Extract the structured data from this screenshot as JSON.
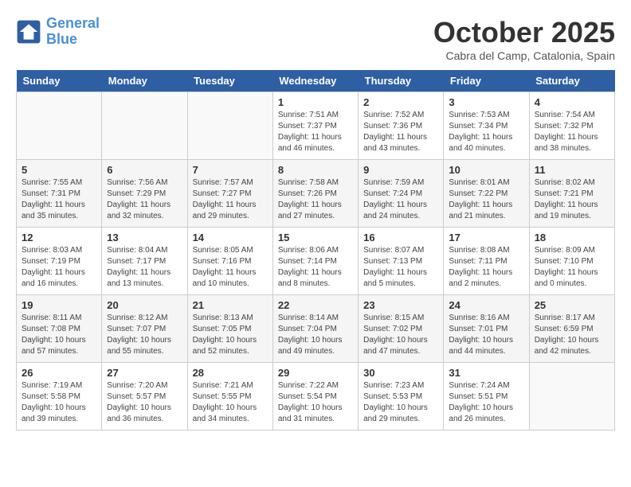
{
  "header": {
    "logo_line1": "General",
    "logo_line2": "Blue",
    "month": "October 2025",
    "location": "Cabra del Camp, Catalonia, Spain"
  },
  "days_of_week": [
    "Sunday",
    "Monday",
    "Tuesday",
    "Wednesday",
    "Thursday",
    "Friday",
    "Saturday"
  ],
  "weeks": [
    [
      {
        "day": "",
        "info": ""
      },
      {
        "day": "",
        "info": ""
      },
      {
        "day": "",
        "info": ""
      },
      {
        "day": "1",
        "info": "Sunrise: 7:51 AM\nSunset: 7:37 PM\nDaylight: 11 hours\nand 46 minutes."
      },
      {
        "day": "2",
        "info": "Sunrise: 7:52 AM\nSunset: 7:36 PM\nDaylight: 11 hours\nand 43 minutes."
      },
      {
        "day": "3",
        "info": "Sunrise: 7:53 AM\nSunset: 7:34 PM\nDaylight: 11 hours\nand 40 minutes."
      },
      {
        "day": "4",
        "info": "Sunrise: 7:54 AM\nSunset: 7:32 PM\nDaylight: 11 hours\nand 38 minutes."
      }
    ],
    [
      {
        "day": "5",
        "info": "Sunrise: 7:55 AM\nSunset: 7:31 PM\nDaylight: 11 hours\nand 35 minutes."
      },
      {
        "day": "6",
        "info": "Sunrise: 7:56 AM\nSunset: 7:29 PM\nDaylight: 11 hours\nand 32 minutes."
      },
      {
        "day": "7",
        "info": "Sunrise: 7:57 AM\nSunset: 7:27 PM\nDaylight: 11 hours\nand 29 minutes."
      },
      {
        "day": "8",
        "info": "Sunrise: 7:58 AM\nSunset: 7:26 PM\nDaylight: 11 hours\nand 27 minutes."
      },
      {
        "day": "9",
        "info": "Sunrise: 7:59 AM\nSunset: 7:24 PM\nDaylight: 11 hours\nand 24 minutes."
      },
      {
        "day": "10",
        "info": "Sunrise: 8:01 AM\nSunset: 7:22 PM\nDaylight: 11 hours\nand 21 minutes."
      },
      {
        "day": "11",
        "info": "Sunrise: 8:02 AM\nSunset: 7:21 PM\nDaylight: 11 hours\nand 19 minutes."
      }
    ],
    [
      {
        "day": "12",
        "info": "Sunrise: 8:03 AM\nSunset: 7:19 PM\nDaylight: 11 hours\nand 16 minutes."
      },
      {
        "day": "13",
        "info": "Sunrise: 8:04 AM\nSunset: 7:17 PM\nDaylight: 11 hours\nand 13 minutes."
      },
      {
        "day": "14",
        "info": "Sunrise: 8:05 AM\nSunset: 7:16 PM\nDaylight: 11 hours\nand 10 minutes."
      },
      {
        "day": "15",
        "info": "Sunrise: 8:06 AM\nSunset: 7:14 PM\nDaylight: 11 hours\nand 8 minutes."
      },
      {
        "day": "16",
        "info": "Sunrise: 8:07 AM\nSunset: 7:13 PM\nDaylight: 11 hours\nand 5 minutes."
      },
      {
        "day": "17",
        "info": "Sunrise: 8:08 AM\nSunset: 7:11 PM\nDaylight: 11 hours\nand 2 minutes."
      },
      {
        "day": "18",
        "info": "Sunrise: 8:09 AM\nSunset: 7:10 PM\nDaylight: 11 hours\nand 0 minutes."
      }
    ],
    [
      {
        "day": "19",
        "info": "Sunrise: 8:11 AM\nSunset: 7:08 PM\nDaylight: 10 hours\nand 57 minutes."
      },
      {
        "day": "20",
        "info": "Sunrise: 8:12 AM\nSunset: 7:07 PM\nDaylight: 10 hours\nand 55 minutes."
      },
      {
        "day": "21",
        "info": "Sunrise: 8:13 AM\nSunset: 7:05 PM\nDaylight: 10 hours\nand 52 minutes."
      },
      {
        "day": "22",
        "info": "Sunrise: 8:14 AM\nSunset: 7:04 PM\nDaylight: 10 hours\nand 49 minutes."
      },
      {
        "day": "23",
        "info": "Sunrise: 8:15 AM\nSunset: 7:02 PM\nDaylight: 10 hours\nand 47 minutes."
      },
      {
        "day": "24",
        "info": "Sunrise: 8:16 AM\nSunset: 7:01 PM\nDaylight: 10 hours\nand 44 minutes."
      },
      {
        "day": "25",
        "info": "Sunrise: 8:17 AM\nSunset: 6:59 PM\nDaylight: 10 hours\nand 42 minutes."
      }
    ],
    [
      {
        "day": "26",
        "info": "Sunrise: 7:19 AM\nSunset: 5:58 PM\nDaylight: 10 hours\nand 39 minutes."
      },
      {
        "day": "27",
        "info": "Sunrise: 7:20 AM\nSunset: 5:57 PM\nDaylight: 10 hours\nand 36 minutes."
      },
      {
        "day": "28",
        "info": "Sunrise: 7:21 AM\nSunset: 5:55 PM\nDaylight: 10 hours\nand 34 minutes."
      },
      {
        "day": "29",
        "info": "Sunrise: 7:22 AM\nSunset: 5:54 PM\nDaylight: 10 hours\nand 31 minutes."
      },
      {
        "day": "30",
        "info": "Sunrise: 7:23 AM\nSunset: 5:53 PM\nDaylight: 10 hours\nand 29 minutes."
      },
      {
        "day": "31",
        "info": "Sunrise: 7:24 AM\nSunset: 5:51 PM\nDaylight: 10 hours\nand 26 minutes."
      },
      {
        "day": "",
        "info": ""
      }
    ]
  ]
}
